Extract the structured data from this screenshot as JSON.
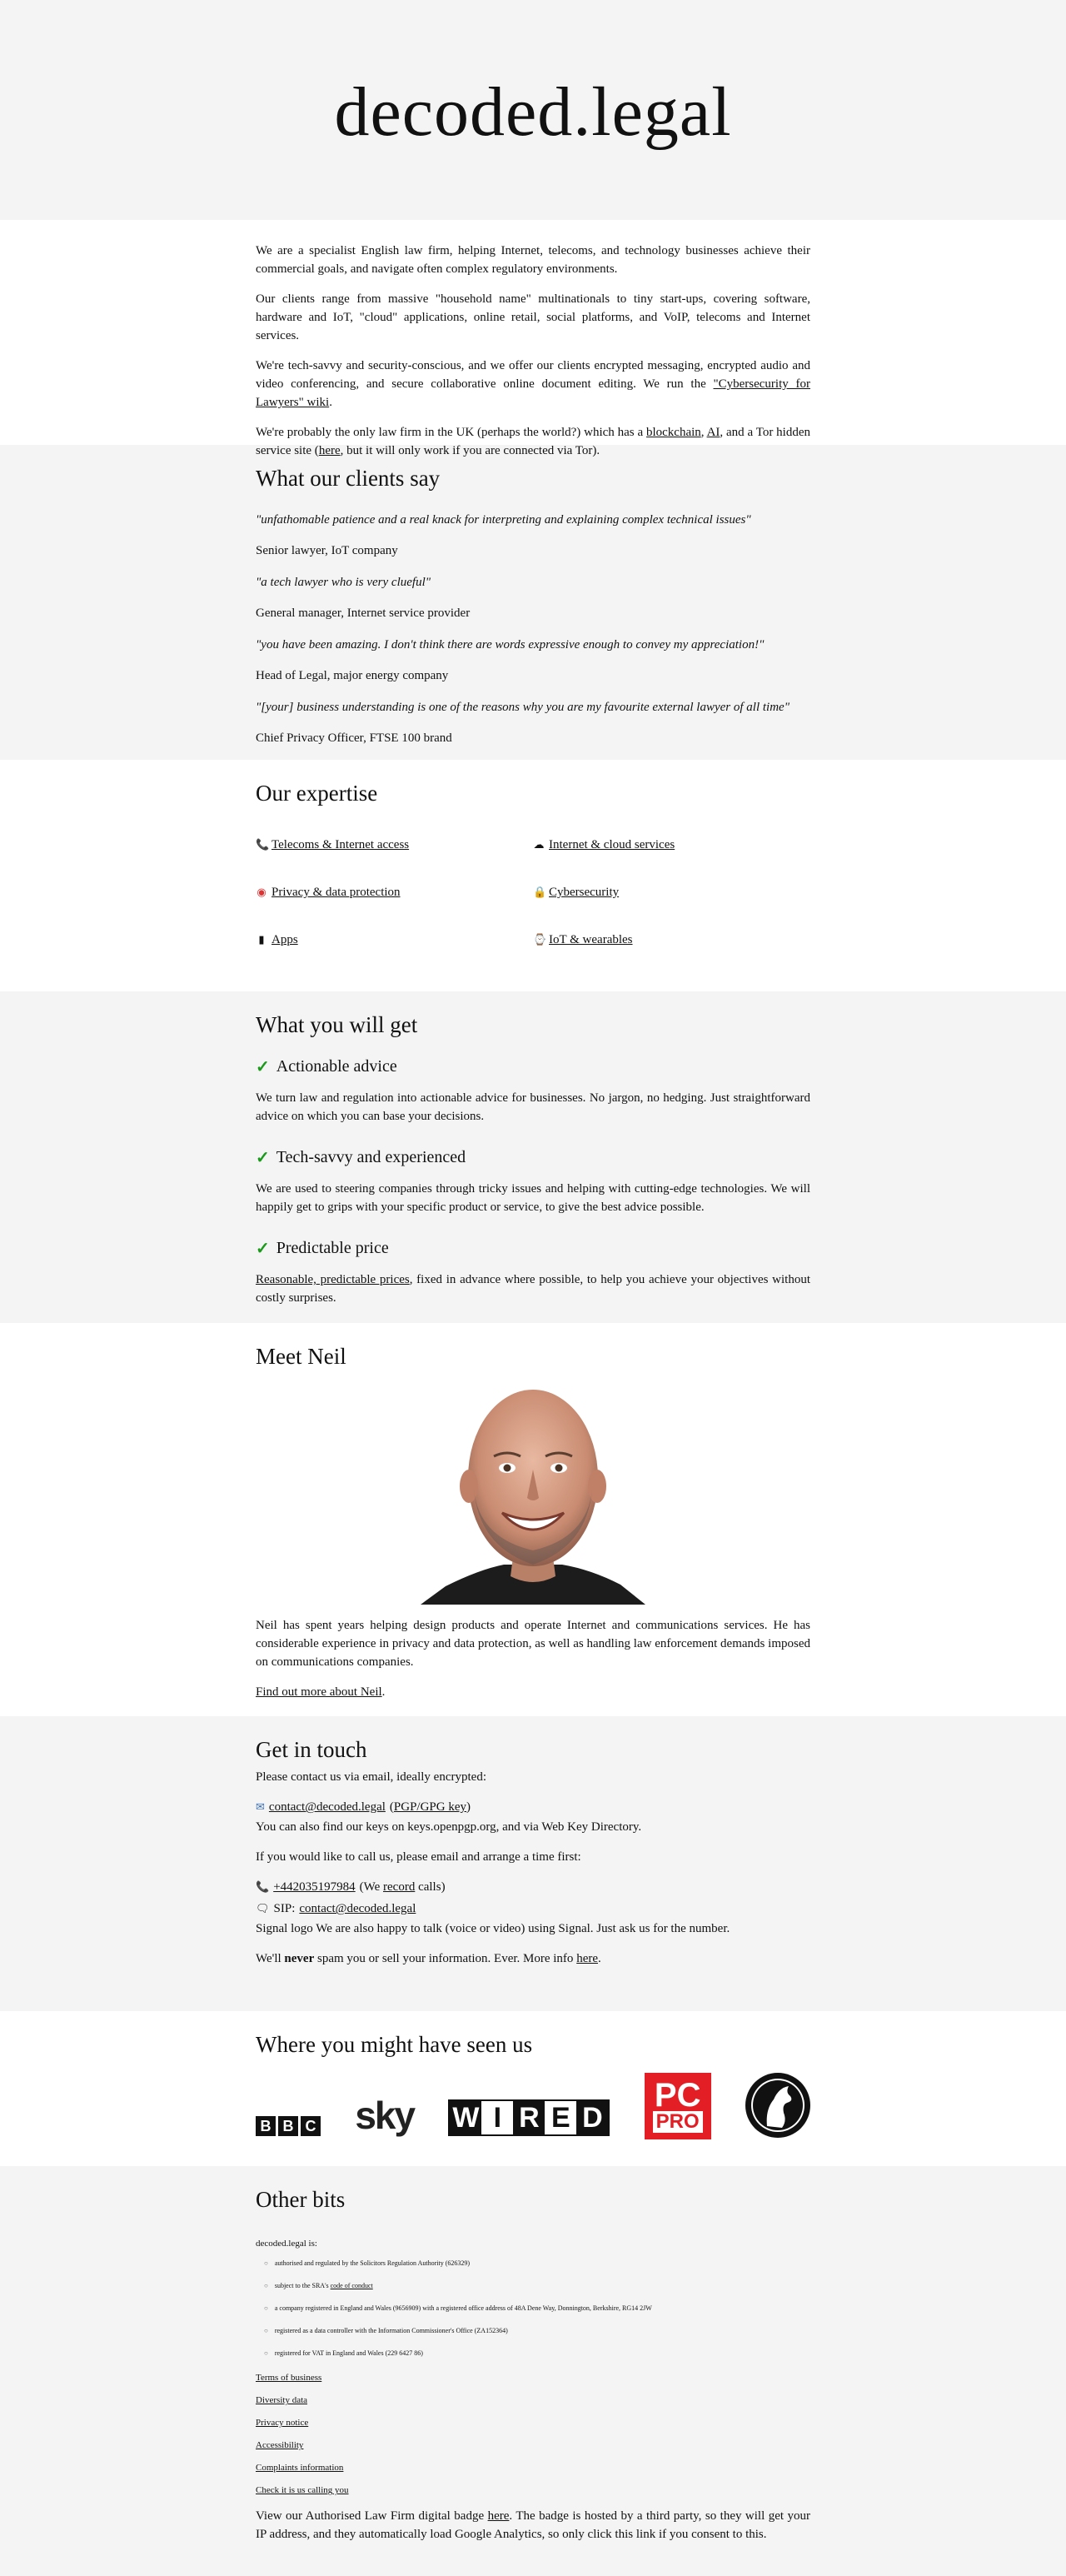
{
  "hero": {
    "title": "decoded.legal"
  },
  "intro": {
    "p1": "We are a specialist English law firm, helping Internet, telecoms, and technology businesses achieve their commercial goals, and navigate often complex regulatory environments.",
    "p2": "Our clients range from massive \"household name\" multinationals to tiny start-ups, covering software, hardware and IoT, \"cloud\" applications, online retail, social platforms, and VoIP, telecoms and Internet services.",
    "p3_before": "We're tech-savvy and security-conscious, and we offer our clients encrypted messaging, encrypted audio and video conferencing, and secure collaborative online document editing. We run the ",
    "p3_link": "\"Cybersecurity for Lawyers\" wiki",
    "p3_after": ".",
    "p4_before": "We're probably the only law firm in the UK (perhaps the world?) which has a ",
    "p4_link1": "blockchain",
    "p4_sep1": ", ",
    "p4_link2": "AI",
    "p4_mid": ", and a Tor hidden service site (",
    "p4_link3": "here",
    "p4_after": ", but it will only work if you are connected via Tor)."
  },
  "clients": {
    "heading": "What our clients say",
    "testimonials": [
      {
        "quote": "\"unfathomable patience and a real knack for interpreting and explaining complex technical issues\"",
        "author": "Senior lawyer, IoT company"
      },
      {
        "quote": "\"a tech lawyer who is very clueful\"",
        "author": "General manager, Internet service provider"
      },
      {
        "quote": "\"you have been amazing. I don't think there are words expressive enough to convey my appreciation!\"",
        "author": "Head of Legal, major energy company"
      },
      {
        "quote": "\"[your] business understanding is one of the reasons why you are my favourite external lawyer of all time\"",
        "author": "Chief Privacy Officer, FTSE 100 brand"
      }
    ]
  },
  "expertise": {
    "heading": "Our expertise",
    "items": [
      {
        "label": "Telecoms & Internet access",
        "icon": "phone-icon"
      },
      {
        "label": "Internet & cloud services",
        "icon": "cloud-icon"
      },
      {
        "label": "Privacy & data protection",
        "icon": "lifebuoy-icon"
      },
      {
        "label": "Cybersecurity",
        "icon": "lock-icon"
      },
      {
        "label": "Apps",
        "icon": "mobile-icon"
      },
      {
        "label": "IoT & wearables",
        "icon": "watch-icon"
      }
    ]
  },
  "wyg": {
    "heading": "What you will get",
    "f1_title": "Actionable advice",
    "f1_text": "We turn law and regulation into actionable advice for businesses. No jargon, no hedging. Just straightforward advice on which you can base your decisions.",
    "f2_title": "Tech-savvy and experienced",
    "f2_text": "We are used to steering companies through tricky issues and helping with cutting-edge technologies. We will happily get to grips with your specific product or service, to give the best advice possible.",
    "f3_title": "Predictable price",
    "f3_link": "Reasonable, predictable prices",
    "f3_after": ", fixed in advance where possible, to help you achieve your objectives without costly surprises."
  },
  "neil": {
    "heading": "Meet Neil",
    "bio": "Neil has spent years helping design products and operate Internet and communications services. He has considerable experience in privacy and data protection, as well as handling law enforcement demands imposed on communications companies.",
    "more_link": "Find out more about Neil",
    "more_after": "."
  },
  "contact": {
    "heading": "Get in touch",
    "intro": "Please contact us via email, ideally encrypted:",
    "email": "contact@decoded.legal",
    "pgp_open": "(",
    "pgp_link": "PGP/GPG key",
    "pgp_close": ")",
    "keys_text": "You can also find our keys on keys.openpgp.org, and via Web Key Directory.",
    "call_text": "If you would like to call us, please email and arrange a time first:",
    "phone": "+442035197984",
    "rec_before": "(We ",
    "rec_link": "record",
    "rec_after": " calls)",
    "sip_label": "SIP:",
    "sip_link": "contact@decoded.legal",
    "signal_text": "Signal logo We are also happy to talk (voice or video) using Signal. Just ask us for the number.",
    "spam_before": "We'll ",
    "spam_bold": "never",
    "spam_mid": " spam you or sell your information. Ever. More info ",
    "spam_link": "here",
    "spam_after": "."
  },
  "seen": {
    "heading": "Where you might have seen us",
    "logos": [
      "BBC",
      "sky",
      "WIRED",
      "PC PRO",
      "horse-head-logo"
    ]
  },
  "other": {
    "heading": "Other bits",
    "intro": "decoded.legal is:",
    "reg": [
      {
        "text": "authorised and regulated by the Solicitors Regulation Authority (626329)"
      },
      {
        "before": "subject to the SRA's ",
        "link": "code of conduct"
      },
      {
        "text": "a company registered in England and Wales (9656909) with a registered office address of 48A Dene Way, Donnington, Berkshire, RG14 2JW"
      },
      {
        "text": "registered as a data controller with the Information Commissioner's Office (ZA152364)"
      },
      {
        "text": "registered for VAT in England and Wales (229 6427 86)"
      }
    ],
    "links": [
      "Terms of business",
      "Diversity data",
      "Privacy notice",
      "Accessibility",
      "Complaints information",
      "Check it is us calling you"
    ],
    "badge_before": "View our Authorised Law Firm digital badge ",
    "badge_link": "here",
    "badge_after": ". The badge is hosted by a third party, so they will get your IP address, and they automatically load Google Analytics, so only click this link if you consent to this."
  }
}
